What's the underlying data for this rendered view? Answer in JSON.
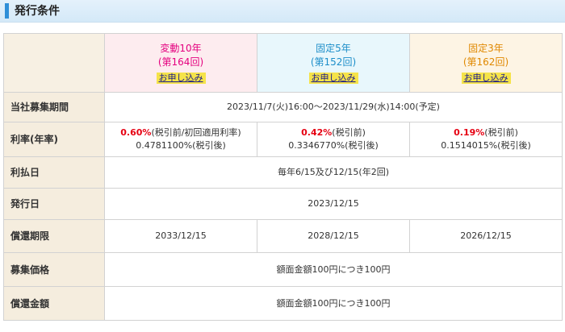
{
  "header": {
    "title": "発行条件"
  },
  "products": [
    {
      "name": "変動10年",
      "series": "(第164回)",
      "apply_label": "お申し込み"
    },
    {
      "name": "固定5年",
      "series": "(第152回)",
      "apply_label": "お申し込み"
    },
    {
      "name": "固定3年",
      "series": "(第162回)",
      "apply_label": "お申し込み"
    }
  ],
  "rows": {
    "period": {
      "label": "当社募集期間",
      "value": "2023/11/7(火)16:00～2023/11/29(水)14:00(予定)"
    },
    "rate": {
      "label": "利率(年率)",
      "cells": [
        {
          "rate": "0.60%",
          "rate_note": "(税引前/初回適用利率)",
          "after": "0.4781100%(税引後)"
        },
        {
          "rate": "0.42%",
          "rate_note": "(税引前)",
          "after": "0.3346770%(税引後)"
        },
        {
          "rate": "0.19%",
          "rate_note": "(税引前)",
          "after": "0.1514015%(税引後)"
        }
      ]
    },
    "interest_date": {
      "label": "利払日",
      "value": "毎年6/15及び12/15(年2回)"
    },
    "issue_date": {
      "label": "発行日",
      "value": "2023/12/15"
    },
    "maturity": {
      "label": "償還期限",
      "values": [
        "2033/12/15",
        "2028/12/15",
        "2026/12/15"
      ]
    },
    "offer_price": {
      "label": "募集価格",
      "value": "額面金額100円につき100円"
    },
    "redemption": {
      "label": "償還金額",
      "value": "額面金額100円につき100円"
    }
  }
}
